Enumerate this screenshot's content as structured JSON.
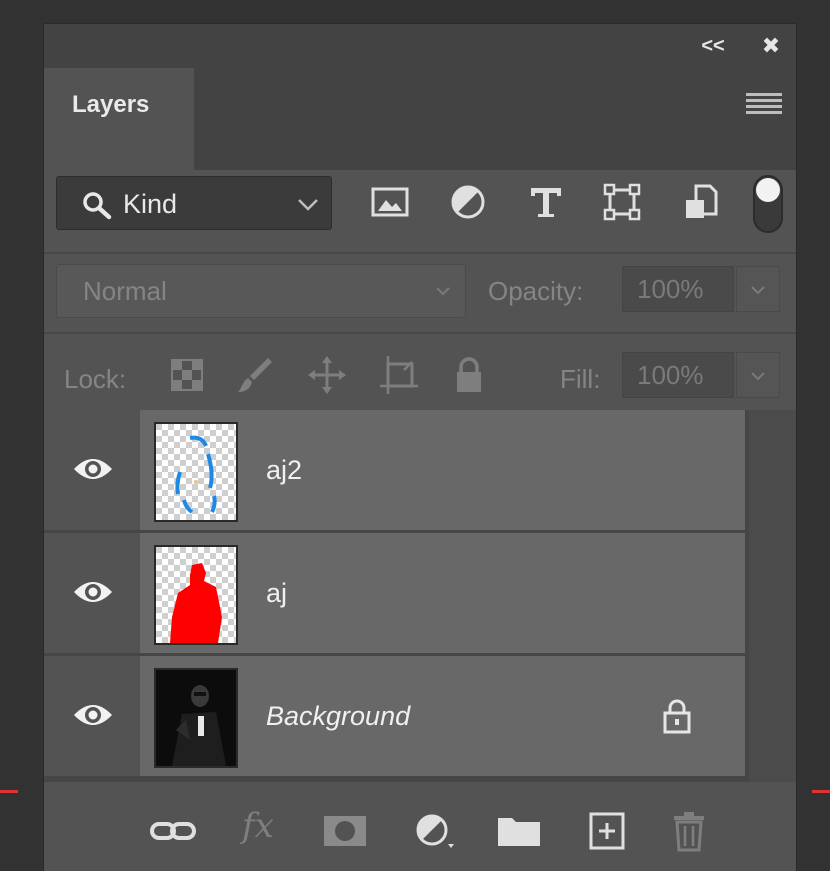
{
  "panel": {
    "collapse_label": "<<",
    "close_label": "✖",
    "tab_label": "Layers",
    "menu_icon": "hamburger-menu-icon"
  },
  "filter": {
    "kind_label": "Kind",
    "search_icon": "search-icon",
    "icons": [
      "pixel-filter-icon",
      "adjustment-filter-icon",
      "type-filter-icon",
      "shape-filter-icon",
      "smart-object-filter-icon",
      "filter-toggle-icon"
    ]
  },
  "blend": {
    "mode": "Normal",
    "opacity_label": "Opacity:",
    "opacity_value": "100%"
  },
  "lock": {
    "label": "Lock:",
    "fill_label": "Fill:",
    "fill_value": "100%"
  },
  "layers": [
    {
      "name": "aj2",
      "visible": true,
      "italic": false,
      "locked": false
    },
    {
      "name": "aj",
      "visible": true,
      "italic": false,
      "locked": false
    },
    {
      "name": "Background",
      "visible": true,
      "italic": true,
      "locked": true
    }
  ],
  "bottom_bar": {
    "fx_label": "fx"
  },
  "colors": {
    "panel_bg": "#535353",
    "layer_bg": "#686868",
    "mask_red": "#ff0000",
    "mask_blue": "#1e88e5"
  }
}
